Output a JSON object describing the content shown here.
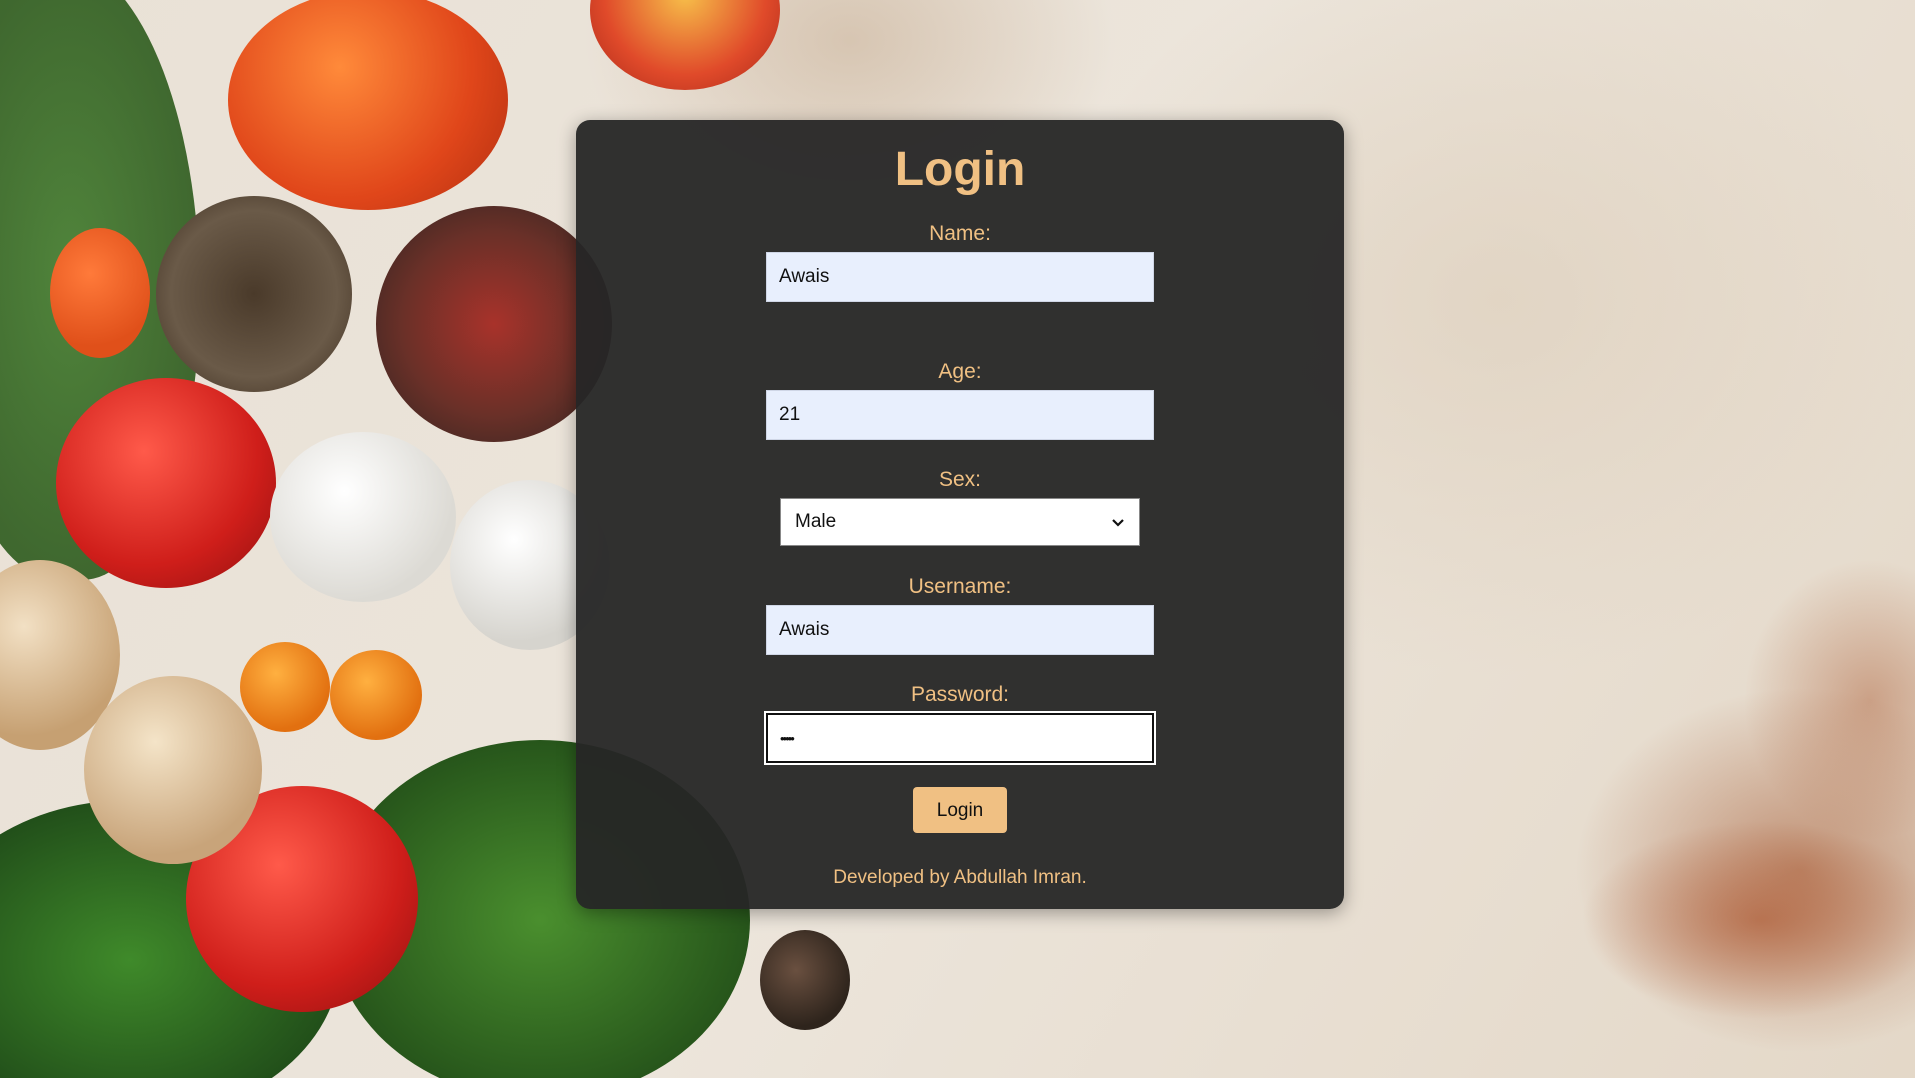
{
  "form": {
    "title": "Login",
    "fields": {
      "name": {
        "label": "Name:",
        "value": "Awais"
      },
      "age": {
        "label": "Age:",
        "value": "21"
      },
      "sex": {
        "label": "Sex:",
        "selected": "Male"
      },
      "username": {
        "label": "Username:",
        "value": "Awais"
      },
      "password": {
        "label": "Password:",
        "value": "•••••"
      }
    },
    "submit_label": "Login",
    "footer": "Developed by Abdullah Imran."
  },
  "icons": {
    "select_chevron": "chevron-down-icon"
  },
  "colors": {
    "accent": "#f0c083",
    "panel": "#262626",
    "input_fill": "#e8effd"
  }
}
